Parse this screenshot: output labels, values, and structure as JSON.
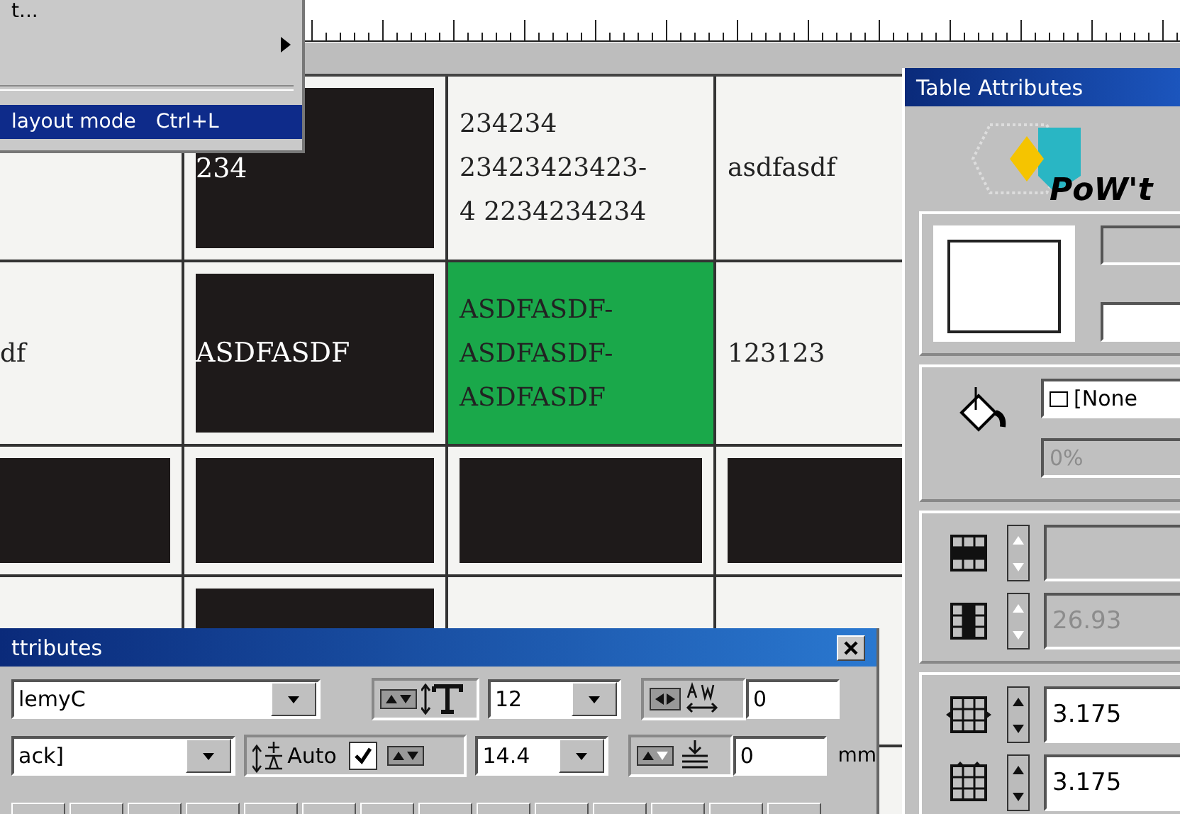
{
  "menu": {
    "items": [
      {
        "kind": "item",
        "label": "t...",
        "selected": false
      },
      {
        "kind": "submenu",
        "selected": false
      },
      {
        "kind": "separator"
      },
      {
        "kind": "item",
        "label": "layout mode",
        "shortcut": "Ctrl+L",
        "selected": true
      }
    ]
  },
  "table": {
    "rows": [
      [
        {
          "kind": "empty"
        },
        {
          "kind": "block",
          "lines": [
            "234"
          ]
        },
        {
          "kind": "text",
          "lines": [
            "234234",
            "23423423423-",
            "4 2234234234"
          ]
        },
        {
          "kind": "text",
          "lines": [
            "asdfasdf"
          ]
        }
      ],
      [
        {
          "kind": "text",
          "lines": [
            "df"
          ]
        },
        {
          "kind": "block",
          "lines": [
            "ASDFASDF"
          ]
        },
        {
          "kind": "green",
          "lines": [
            "ASDFASDF-",
            "ASDFASDF-",
            "ASDFASDF"
          ]
        },
        {
          "kind": "text",
          "lines": [
            "123123"
          ]
        }
      ],
      [
        {
          "kind": "block"
        },
        {
          "kind": "block"
        },
        {
          "kind": "block"
        },
        {
          "kind": "block"
        }
      ],
      [
        {
          "kind": "empty"
        },
        {
          "kind": "block"
        },
        {
          "kind": "empty"
        },
        {
          "kind": "empty"
        }
      ]
    ]
  },
  "table_attributes": {
    "title": "Table Attributes",
    "logo_text": "PoW't",
    "fill": {
      "swatch": "[None",
      "tint": "0%",
      "tint_disabled": true
    },
    "spin_fields": [
      {
        "kind": "rows",
        "disabled": true
      },
      {
        "kind": "columns",
        "value": "26.93",
        "disabled": true
      },
      {
        "kind": "row-spacing",
        "value": "3.175",
        "disabled": false
      },
      {
        "kind": "column-spacing",
        "value": "3.175",
        "disabled": false
      }
    ]
  },
  "char_attributes": {
    "title": "ttributes",
    "font": "lemyC",
    "style": "ack]",
    "size": "12",
    "tracking": "0",
    "leading_label": "Auto",
    "leading_auto": true,
    "leading": "14.4",
    "baseline": "0",
    "unit": "mm"
  }
}
